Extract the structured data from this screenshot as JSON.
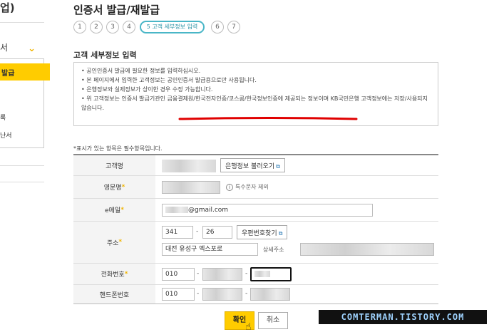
{
  "sidebar": {
    "title": "업)",
    "select_value": "서",
    "active_item": "발급",
    "items": [
      "록",
      "난서"
    ]
  },
  "page": {
    "title": "인증서 발급/재발급",
    "steps": [
      "1",
      "2",
      "3",
      "4",
      "5 고객 세부정보 입력",
      "6",
      "7"
    ],
    "current_step": 5,
    "section_title": "고객 세부정보 입력"
  },
  "notice": [
    "공인인증서 발급에 필요한 정보를 입력하십시오.",
    "본 페이지에서 입력한 고객정보는 공인인증서 발급용으로만 사용됩니다.",
    "은행정보와 실제정보가 상이한 경우 수정 가능합니다.",
    "위 고객정보는 인증서 발급기관인 금융결제원/한국전자인증/코스콤/한국정보인증에 제공되는 정보이며 KB국민은행 고객정보에는 저장/사용되지 않습니다."
  ],
  "required_note": "*표시가 있는 항목은 필수항목입니다.",
  "form": {
    "name": {
      "label": "고객명",
      "button": "은행정보 불러오기"
    },
    "english_name": {
      "label": "영문명",
      "hint": "특수문자 제외"
    },
    "email": {
      "label": "e메일",
      "value": "@gmail.com"
    },
    "address": {
      "label": "주소",
      "zip1": "341",
      "zip2": "26",
      "zip_button": "우편번호찾기",
      "addr1": "대전 유성구  엑스포로",
      "detail_label": "상세주소"
    },
    "phone": {
      "label": "전화번호",
      "part1": "010"
    },
    "mobile": {
      "label": "핸드폰번호",
      "part1": "010"
    }
  },
  "buttons": {
    "confirm": "확인",
    "cancel": "취소"
  },
  "watermark": "COMTERMAN.TISTORY.COM",
  "colors": {
    "accent": "#ffcc00",
    "step_active": "#49b6c7",
    "required": "#f0b400",
    "underline": "#e00000"
  }
}
